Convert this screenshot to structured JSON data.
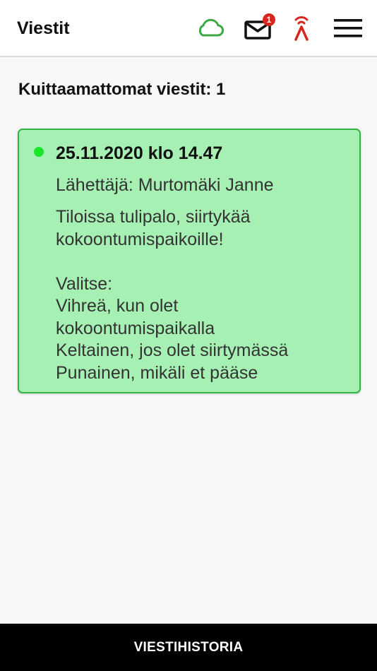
{
  "header": {
    "title": "Viestit",
    "icons": {
      "cloud": "cloud-icon",
      "mail": "mail-icon",
      "signal": "signal-icon",
      "menu": "hamburger-menu-icon"
    },
    "mail_badge": "1",
    "colors": {
      "cloud": "#3ea845",
      "badge": "#d7261e",
      "signal": "#d7261e"
    }
  },
  "main": {
    "unacknowledged_label": "Kuittaamattomat viestit: 1",
    "messages": [
      {
        "date": "25.11.2020 klo 14.47",
        "sender": "Lähettäjä: Murtomäki Janne",
        "body_lines": [
          "Tiloissa tulipalo, siirtykää",
          "kokoontumispaikoille!",
          "",
          "Valitse:",
          "Vihreä, kun olet",
          "kokoontumispaikalla",
          "Keltainen, jos olet siirtymässä",
          "Punainen, mikäli et pääse"
        ],
        "status_color": "#18e626",
        "card_color": "#a6f0b4",
        "border_color": "#33b544"
      }
    ]
  },
  "footer": {
    "history_button": "VIESTIHISTORIA"
  }
}
